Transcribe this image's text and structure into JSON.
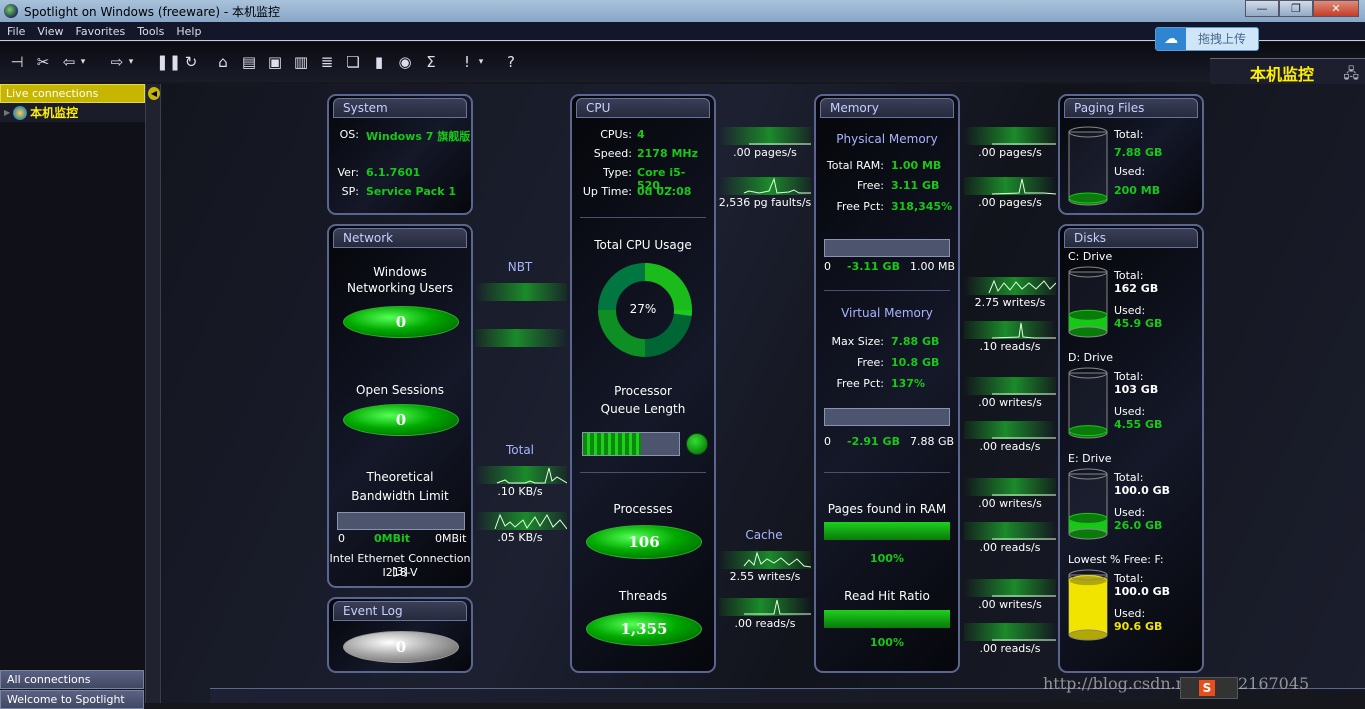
{
  "window": {
    "title": "Spotlight on Windows (freeware) - 本机监控",
    "minimize": "—",
    "maximize": "❐",
    "close": "✕"
  },
  "menu": [
    "File",
    "View",
    "Favorites",
    "Tools",
    "Help"
  ],
  "toolbar": [
    "plug-connect",
    "plug-disconnect",
    "back",
    "forward",
    "pause",
    "refresh",
    "home",
    "list",
    "screen",
    "chip",
    "db",
    "windows",
    "bars",
    "disk",
    "sigma",
    "alert",
    "help"
  ],
  "upload": {
    "label": "拖拽上传"
  },
  "banner": {
    "title": "本机监控"
  },
  "sidebar": {
    "live": "Live connections",
    "node": "本机监控",
    "all": "All connections",
    "welcome": "Welcome to Spotlight"
  },
  "system": {
    "title": "System",
    "os_label": "OS:",
    "os": "Windows 7 旗舰版",
    "ver_label": "Ver:",
    "ver": "6.1.7601",
    "sp_label": "SP:",
    "sp": "Service Pack 1"
  },
  "network": {
    "title": "Network",
    "users_label": "Windows\nNetworking Users",
    "users": "0",
    "sessions_label": "Open Sessions",
    "sessions": "0",
    "bw_label1": "Theoretical",
    "bw_label2": "Bandwidth Limit",
    "bw_min": "0",
    "bw_cur": "0MBit",
    "bw_max": "0MBit",
    "adapter1": "Intel Ethernet Connection [3]",
    "adapter2": "I218-V"
  },
  "eventlog": {
    "title": "Event Log",
    "value": "0"
  },
  "nbt": {
    "label": "NBT"
  },
  "total": {
    "label": "Total",
    "send": ".10 KB/s",
    "recv": ".05 KB/s"
  },
  "cpu": {
    "title": "CPU",
    "cpus_label": "CPUs:",
    "cpus": "4",
    "speed_label": "Speed:",
    "speed": "2178 MHz",
    "type_label": "Type:",
    "type": "Core i5-520...",
    "uptime_label": "Up Time:",
    "uptime": "0d 02:08",
    "usage_label": "Total CPU Usage",
    "usage": "27%",
    "usage_pct": 27,
    "queue_label1": "Processor",
    "queue_label2": "Queue Length",
    "queue_fill": 0.6,
    "processes_label": "Processes",
    "processes": "106",
    "threads_label": "Threads",
    "threads": "1,355"
  },
  "cpu_mem": {
    "pages": ".00 pages/s",
    "faults": "2,536 pg faults/s"
  },
  "cache": {
    "label": "Cache",
    "writes": "2.55 writes/s",
    "reads": ".00 reads/s"
  },
  "memory": {
    "title": "Memory",
    "phys_title": "Physical Memory",
    "total_label": "Total RAM:",
    "total": "1.00 MB",
    "free_label": "Free:",
    "free": "3.11 GB",
    "freepct_label": "Free Pct:",
    "freepct": "318,345%",
    "phys_min": "0",
    "phys_cur": "-3.11 GB",
    "phys_max": "1.00 MB",
    "virt_title": "Virtual Memory",
    "max_label": "Max Size:",
    "max": "7.88 GB",
    "vfree_label": "Free:",
    "vfree": "10.8 GB",
    "vfreepct_label": "Free Pct:",
    "vfreepct": "137%",
    "virt_min": "0",
    "virt_cur": "-2.91 GB",
    "virt_max": "7.88 GB",
    "pages_label": "Pages found in RAM",
    "pages_pct": "100%",
    "hit_label": "Read Hit Ratio",
    "hit_pct": "100%"
  },
  "mem_page": {
    "out": ".00 pages/s",
    "in": ".00 pages/s"
  },
  "paging": {
    "title": "Paging Files",
    "total_label": "Total:",
    "total": "7.88 GB",
    "used_label": "Used:",
    "used": "200 MB",
    "fill": 0.03
  },
  "disk_flows": [
    {
      "w": "2.75 writes/s",
      "r": ".10 reads/s"
    },
    {
      "w": ".00 writes/s",
      "r": ".00 reads/s"
    },
    {
      "w": ".00 writes/s",
      "r": ".00 reads/s"
    },
    {
      "w": ".00 writes/s",
      "r": ".00 reads/s"
    }
  ],
  "disks": {
    "title": "Disks",
    "items": [
      {
        "name": "C: Drive",
        "total_label": "Total:",
        "total": "162 GB",
        "used_label": "Used:",
        "used": "45.9 GB",
        "fill": 0.28,
        "color": "#18c818"
      },
      {
        "name": "D: Drive",
        "total_label": "Total:",
        "total": "103 GB",
        "used_label": "Used:",
        "used": "4.55 GB",
        "fill": 0.04,
        "color": "#18c818"
      },
      {
        "name": "E: Drive",
        "total_label": "Total:",
        "total": "100.0 GB",
        "used_label": "Used:",
        "used": "26.0 GB",
        "fill": 0.26,
        "color": "#18c818"
      },
      {
        "name": "Lowest % Free: F:",
        "total_label": "Total:",
        "total": "100.0 GB",
        "used_label": "Used:",
        "used": "90.6 GB",
        "fill": 0.906,
        "color": "#f0e400"
      }
    ]
  },
  "watermark": "http://blog.csdn.net/u012167045"
}
